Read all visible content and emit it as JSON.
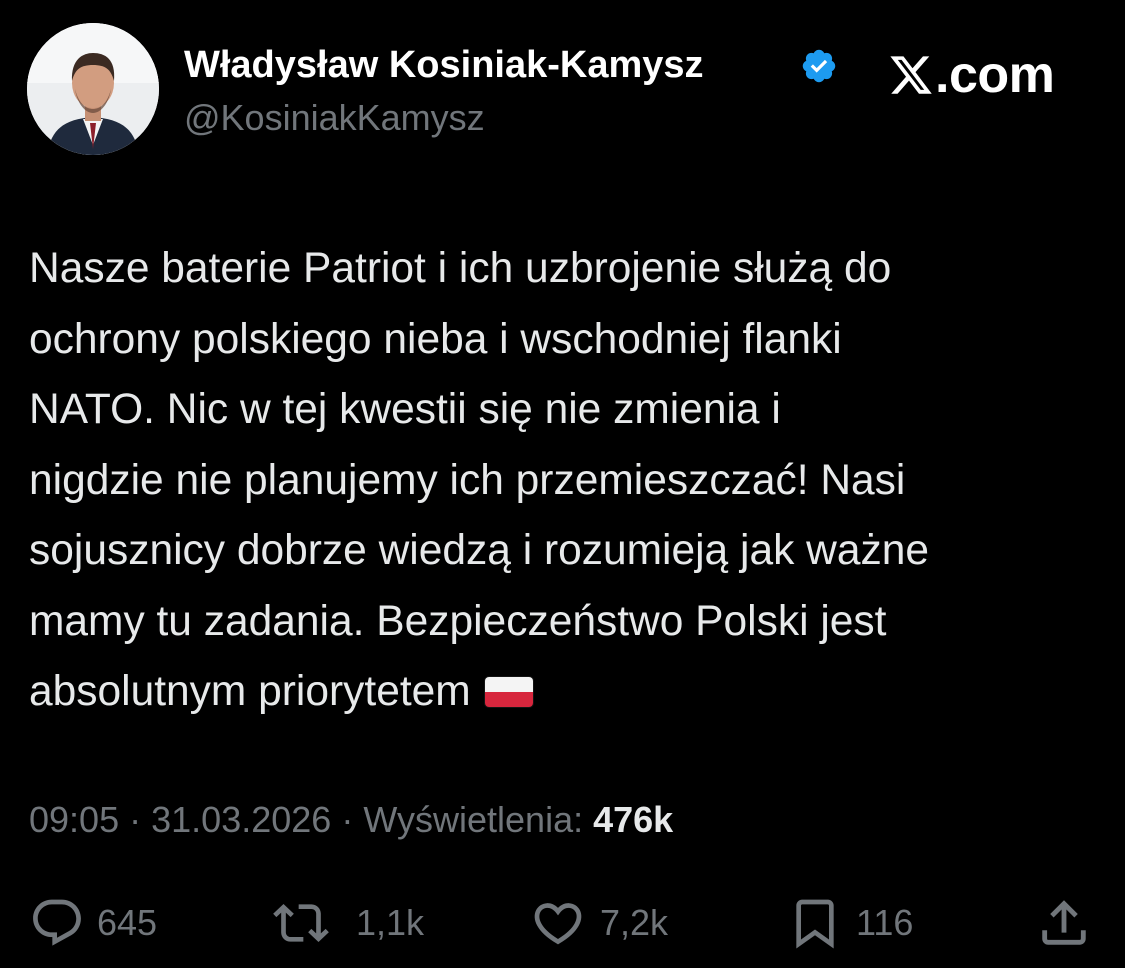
{
  "author": {
    "display_name": "Władysław Kosiniak-Kamysz",
    "handle": "@KosiniakKamysz",
    "verified": true
  },
  "brand": {
    "text": ".com",
    "logo_icon": "x-logo-icon"
  },
  "tweet": {
    "lines": [
      "Nasze baterie Patriot i ich uzbrojenie służą do",
      "ochrony polskiego nieba i wschodniej flanki",
      "NATO. Nic w tej kwestii się nie zmienia i",
      "nigdzie nie planujemy ich przemieszczać! Nasi",
      "sojusznicy dobrze wiedzą i rozumieją jak ważne",
      "mamy tu zadania. Bezpieczeństwo Polski jest",
      "absolutnym priorytetem"
    ],
    "emoji": "poland-flag-icon"
  },
  "meta": {
    "time": "09:05",
    "separator": "·",
    "date": "31.03.2026",
    "views_label": "Wyświetlenia:",
    "views_count": "476k"
  },
  "actions": {
    "replies": "645",
    "reposts": "1,1k",
    "likes": "7,2k",
    "bookmarks": "116"
  },
  "colors": {
    "background": "#000000",
    "text": "#e7e9ea",
    "secondary": "#71767b",
    "verified_blue": "#1d9bf0"
  }
}
